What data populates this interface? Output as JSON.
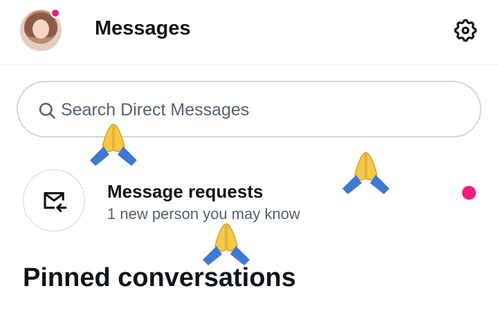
{
  "header": {
    "title": "Messages",
    "avatar_icon": "profile-avatar",
    "notification_color": "#f91880",
    "settings_icon": "gear-icon"
  },
  "search": {
    "placeholder": "Search Direct Messages",
    "value": "",
    "icon": "search-icon"
  },
  "message_requests": {
    "title": "Message requests",
    "subtitle": "1 new person you may know",
    "icon": "envelope-arrow-icon",
    "unread_dot_color": "#f91880"
  },
  "pinned": {
    "heading": "Pinned conversations"
  },
  "overlay_emoji": "folded-hands",
  "colors": {
    "text_primary": "#0f1419",
    "text_secondary": "#536471",
    "border": "#cfd9de",
    "accent": "#f91880"
  }
}
